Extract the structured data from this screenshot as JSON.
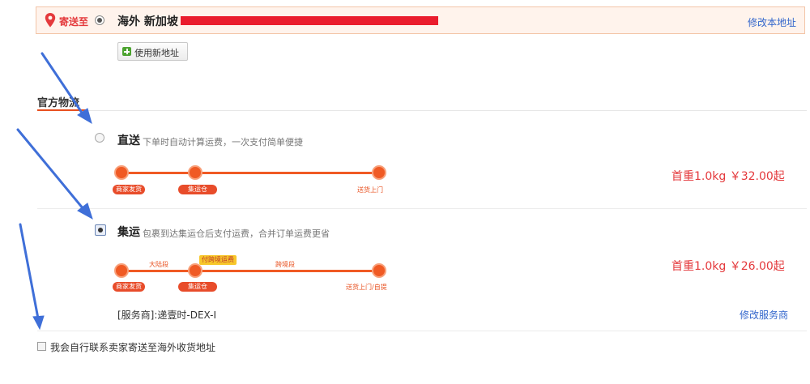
{
  "address": {
    "ship_to_label": "寄送至",
    "address_text": "海外 新加坡",
    "edit_link": "修改本地址"
  },
  "new_address_button": "使用新地址",
  "section_title": "官方物流",
  "options": [
    {
      "name": "直送",
      "description": "下单时自动计算运费，一次支付简单便捷",
      "selected": false,
      "nodes": [
        "商家发货",
        "集运仓",
        "送货上门"
      ],
      "price": "首重1.0kg ￥32.00起"
    },
    {
      "name": "集运",
      "description": "包裹到达集运仓后支付运费，合并订单运费更省",
      "selected": true,
      "nodes": [
        "商家发货",
        "集运仓",
        "送货上门/自提"
      ],
      "segments": [
        "大陆段",
        "跨境段"
      ],
      "tag": "付跨境运费",
      "price": "首重1.0kg ￥26.00起",
      "provider": "[服务商]:递壹时-DEX-I",
      "edit_provider": "修改服务商"
    }
  ],
  "self_contact_checkbox": {
    "label": "我会自行联系卖家寄送至海外收货地址",
    "checked": false
  },
  "colors": {
    "accent_orange": "#f05a24",
    "price_red": "#e4393c",
    "link_blue": "#3366cc",
    "redaction_red": "#ea1c2d",
    "annotation_arrow": "#3f6fd8"
  }
}
